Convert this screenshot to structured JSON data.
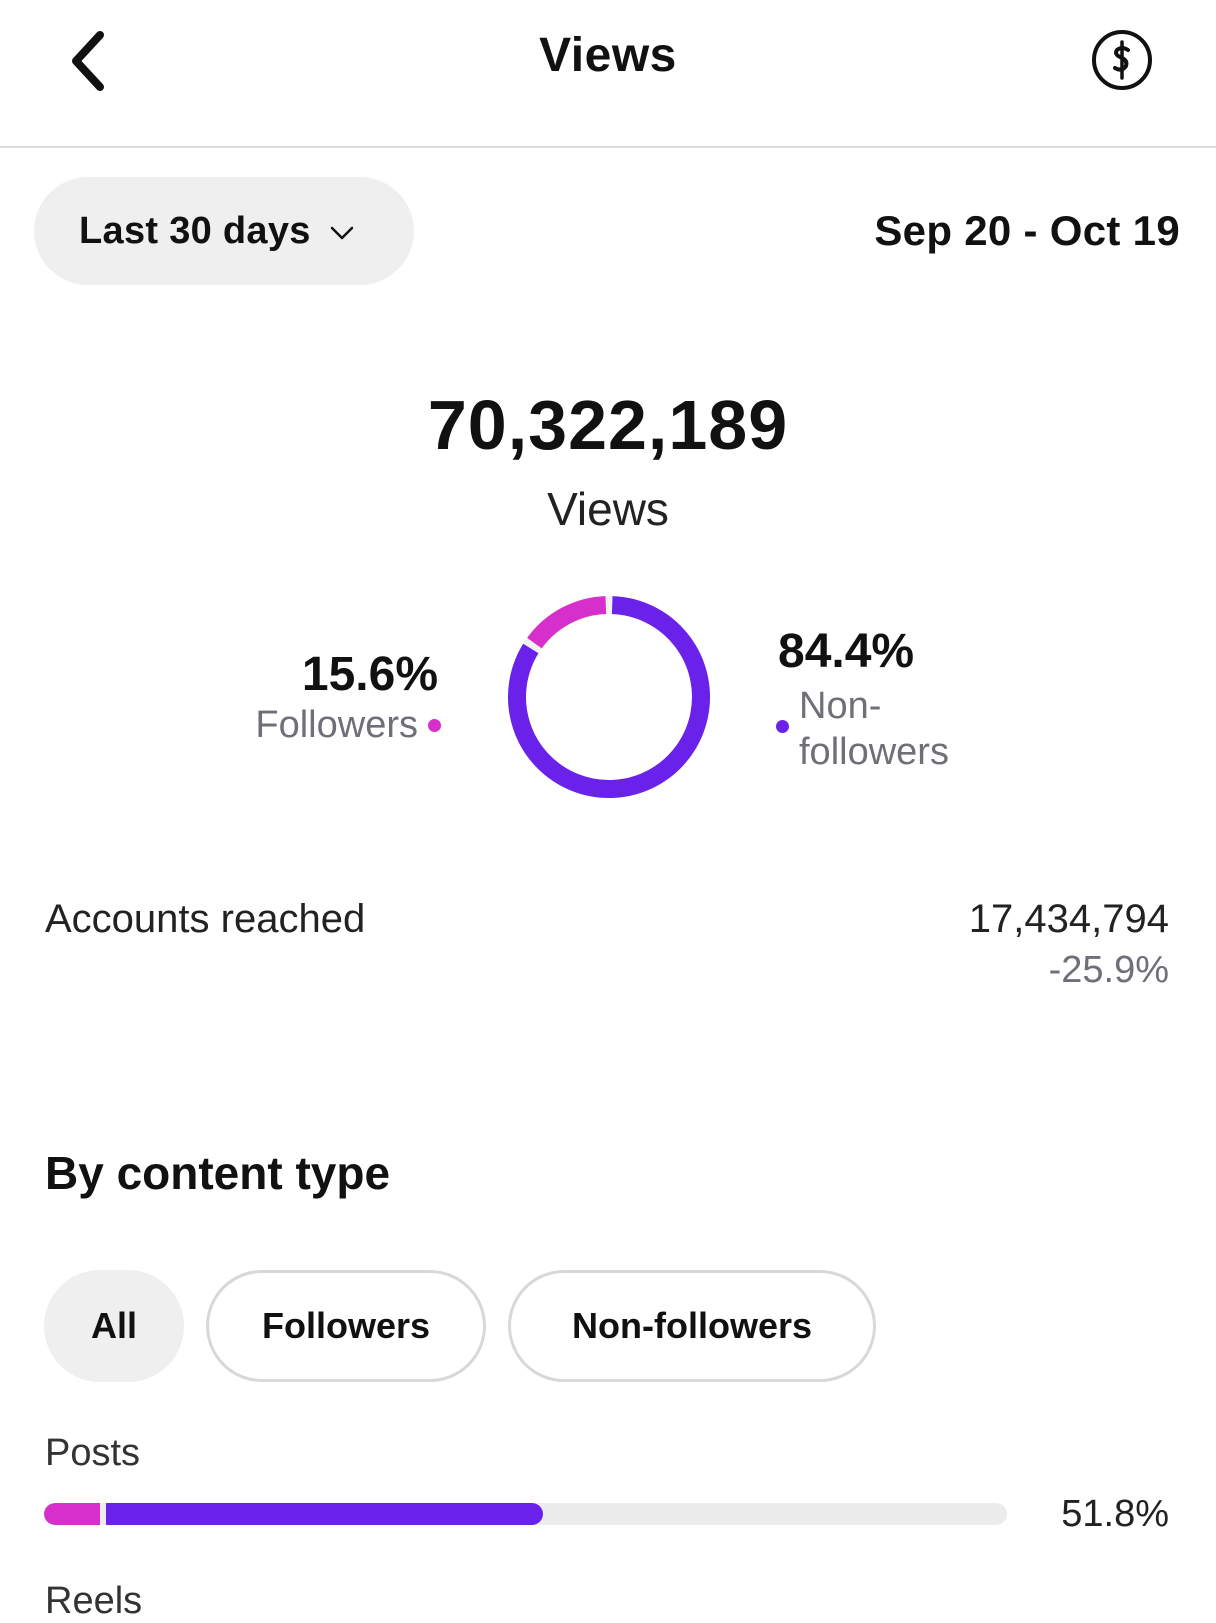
{
  "header": {
    "title": "Views",
    "back_icon": "chevron-left-icon",
    "coin_icon": "dollar-coin-icon"
  },
  "filter": {
    "period_label": "Last 30 days",
    "date_range": "Sep 20 - Oct 19"
  },
  "summary": {
    "total_views": "70,322,189",
    "views_label": "Views",
    "followers_pct": "15.6%",
    "followers_label": "Followers",
    "nonfollowers_pct": "84.4%",
    "nonfollowers_label": "Non-followers",
    "followers_fraction": 0.156,
    "nonfollowers_fraction": 0.844
  },
  "accounts": {
    "label": "Accounts reached",
    "value": "17,434,794",
    "change": "-25.9%"
  },
  "content_type": {
    "title": "By content type",
    "tabs": [
      {
        "label": "All",
        "active": true
      },
      {
        "label": "Followers",
        "active": false
      },
      {
        "label": "Non-followers",
        "active": false
      }
    ],
    "rows": [
      {
        "label": "Posts",
        "value": "51.8%",
        "total_fraction": 0.518,
        "followers_fraction": 0.058
      },
      {
        "label": "Reels"
      }
    ]
  },
  "colors": {
    "followers": "#d62fcb",
    "nonfollowers": "#6a22ea",
    "track": "#ececec"
  }
}
